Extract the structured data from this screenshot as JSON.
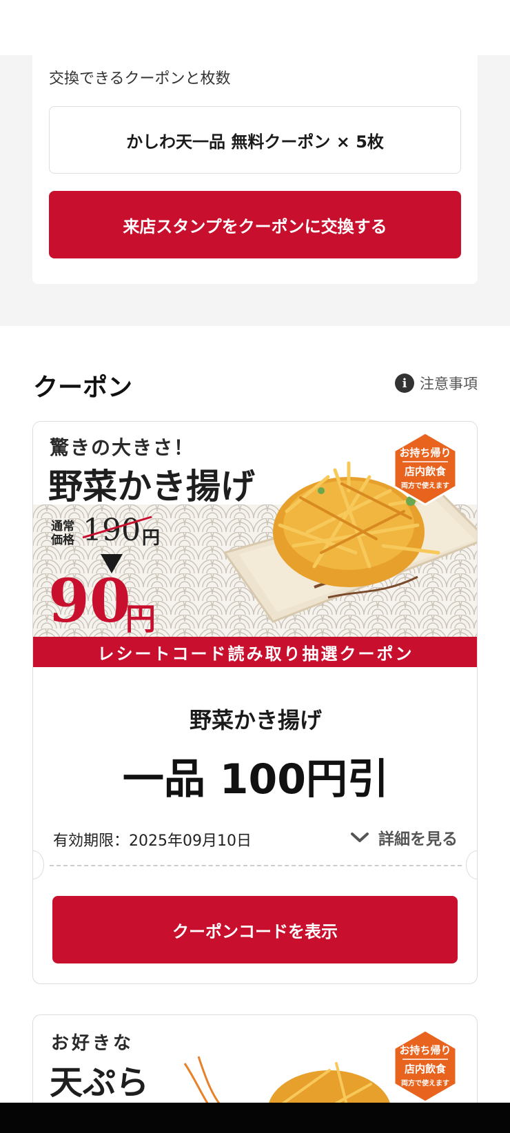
{
  "stamp_section": {
    "heading": "交換できるクーポンと枚数",
    "coupon_count": "かしわ天一品 無料クーポン × 5枚",
    "exchange_button": "来店スタンプをクーポンに交換する"
  },
  "coupon_section": {
    "title": "クーポン",
    "notice_label": "注意事項",
    "notice_icon": "i"
  },
  "coupon": {
    "banner": {
      "catch": "驚きの大きさ！",
      "name": "野菜かき揚げ",
      "regular_label": "通常価格",
      "regular_price": "190",
      "regular_yen": "円",
      "sale_price": "90",
      "sale_yen": "円",
      "badge_line1": "お持ち帰り",
      "badge_line2": "店内飲食",
      "badge_line3": "両方で使えます",
      "strip": "レシートコード読み取り抽選クーポン"
    },
    "item": "野菜かき揚げ",
    "discount": "一品 100円引",
    "expiry": "有効期限：2025年09月10日",
    "detail_label": "詳細を見る",
    "code_button": "クーポンコードを表示"
  },
  "coupon2": {
    "catch": "お好きな",
    "name": "天ぷら",
    "badge_line1": "お持ち帰り",
    "badge_line2": "店内飲食",
    "badge_line3": "両方で使えます"
  },
  "colors": {
    "brand_red": "#c8102e",
    "background_gray": "#f4f4f4",
    "badge_orange": "#e8641e"
  }
}
